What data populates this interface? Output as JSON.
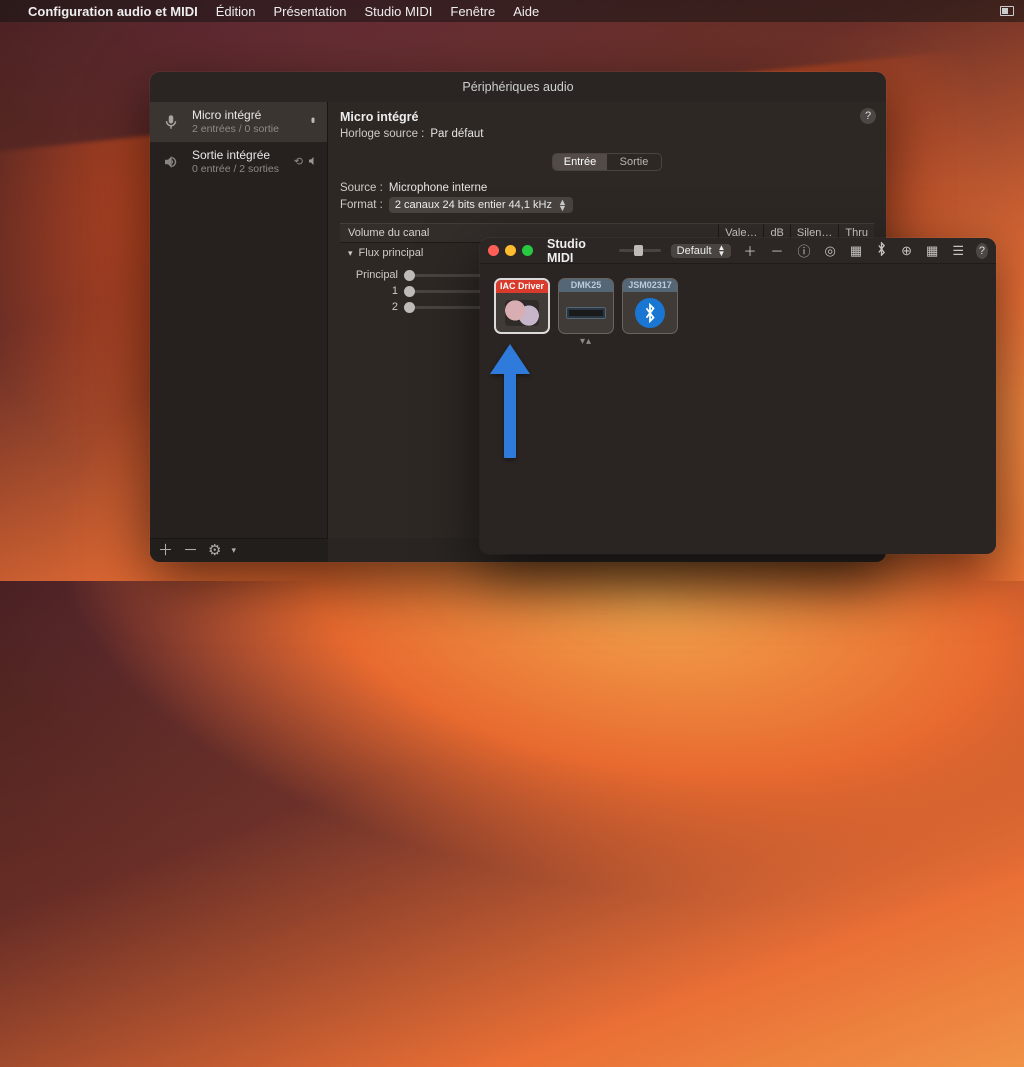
{
  "menubar": {
    "app_name": "Configuration audio et MIDI",
    "items": [
      "Édition",
      "Présentation",
      "Studio MIDI",
      "Fenêtre",
      "Aide"
    ]
  },
  "audio_window": {
    "title": "Périphériques audio",
    "devices": [
      {
        "name": "Micro intégré",
        "sub": "2 entrées / 0 sortie",
        "selected": true,
        "icon": "mic",
        "trail": [
          "mic"
        ]
      },
      {
        "name": "Sortie intégrée",
        "sub": "0 entrée / 2 sorties",
        "selected": false,
        "icon": "speaker",
        "trail": [
          "loop",
          "vol"
        ]
      }
    ],
    "detail": {
      "heading": "Micro intégré",
      "clock_label": "Horloge source :",
      "clock_value": "Par défaut",
      "tabs": {
        "in": "Entrée",
        "out": "Sortie",
        "active": "in"
      },
      "source_label": "Source :",
      "source_value": "Microphone interne",
      "format_label": "Format :",
      "format_value": "2 canaux 24 bits entier 44,1 kHz",
      "section": {
        "title": "Volume du canal",
        "cols": [
          "Vale…",
          "dB",
          "Silen…",
          "Thru"
        ]
      },
      "disclosure": "Flux principal",
      "channels": [
        "Principal",
        "1",
        "2"
      ]
    },
    "footer_icons": [
      "+",
      "−",
      "gear"
    ]
  },
  "midi_window": {
    "title": "Studio MIDI",
    "config_label": "Default",
    "toolbar_icons": [
      "plus",
      "minus",
      "info",
      "target",
      "test",
      "bluetooth",
      "network",
      "grid",
      "list",
      "help"
    ],
    "devices": [
      {
        "label": "IAC Driver",
        "kind": "iac",
        "selected": true
      },
      {
        "label": "DMK25",
        "kind": "rack"
      },
      {
        "label": "JSM02317",
        "kind": "bt"
      }
    ]
  }
}
